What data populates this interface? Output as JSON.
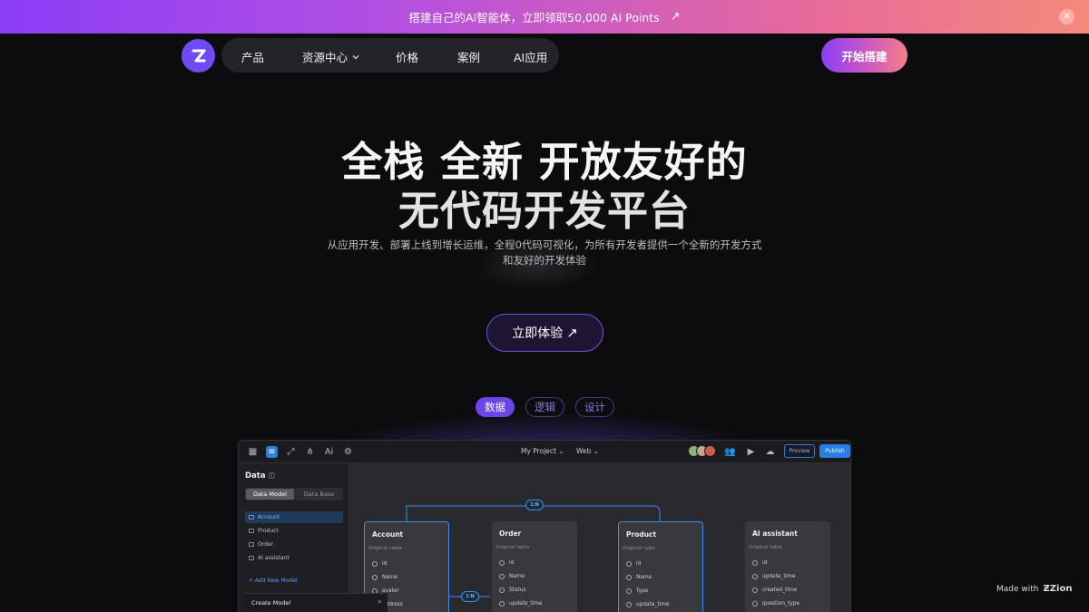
{
  "banner": {
    "text": "搭建自己的AI智能体，立即领取50,000 AI Points",
    "arrow_icon": "arrow-up-right-icon",
    "close_icon": "close-icon"
  },
  "nav": {
    "logo_icon": "zion-logo-icon",
    "items": [
      "产品",
      "资源中心",
      "价格",
      "案例",
      "AI应用"
    ],
    "cta": "开始搭建"
  },
  "hero": {
    "title_line1": "全栈 全新 开放友好的",
    "title_line2": "无代码开发平台",
    "subtitle_line1": "从应用开发、部署上线到增长运维，全程0代码可视化，为所有开发者提供一个全新的开发方式",
    "subtitle_line2": "和友好的开发体验",
    "cta": "立即体验"
  },
  "tabs": [
    {
      "label": "数据",
      "active": true
    },
    {
      "label": "逻辑",
      "active": false
    },
    {
      "label": "设计",
      "active": false
    }
  ],
  "app": {
    "project": "My Project",
    "platform": "Web",
    "preview": "Preview",
    "publish": "Publish",
    "sidebar": {
      "title": "Data",
      "seg_on": "Data Model",
      "seg_off": "Data Base",
      "items": [
        "Account",
        "Product",
        "Order",
        "AI assistant"
      ],
      "add": "+ Add New Model",
      "create": "Create Model"
    },
    "cards": [
      {
        "title": "Account",
        "sub": "Original table",
        "fields": [
          "id",
          "Name",
          "avater",
          "address"
        ]
      },
      {
        "title": "Order",
        "sub": "Original table",
        "fields": [
          "id",
          "Name",
          "Status",
          "update_time"
        ]
      },
      {
        "title": "Product",
        "sub": "Original type",
        "fields": [
          "id",
          "Name",
          "Type",
          "update_time"
        ]
      },
      {
        "title": "AI assistant",
        "sub": "Original table",
        "fields": [
          "id",
          "update_time",
          "created_time",
          "question_type"
        ]
      }
    ],
    "relations": [
      "1:N",
      "1:N"
    ]
  },
  "footer": {
    "made_with": "Made with",
    "brand": "Zion"
  }
}
